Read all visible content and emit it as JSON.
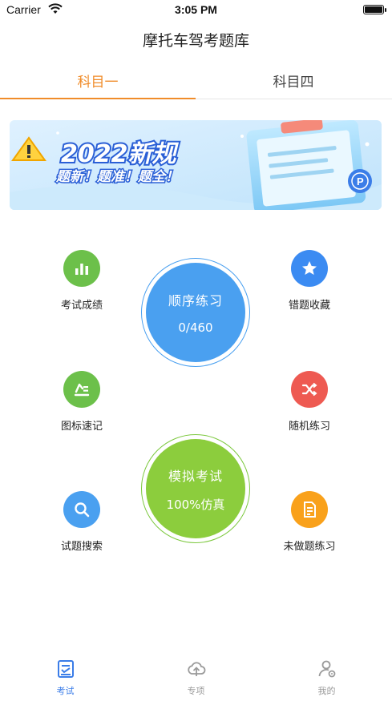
{
  "status_bar": {
    "carrier": "Carrier",
    "time": "3:05 PM"
  },
  "nav": {
    "title": "摩托车驾考题库"
  },
  "tabs": [
    {
      "label": "科目一",
      "active": true
    },
    {
      "label": "科目四",
      "active": false
    }
  ],
  "banner": {
    "headline": "2022新规",
    "subline": "题新！题准！题全！"
  },
  "left_menu": [
    {
      "label": "考试成绩",
      "icon": "bar-chart-icon",
      "color": "#6cc04a"
    },
    {
      "label": "图标速记",
      "icon": "sign-memo-icon",
      "color": "#6cc04a"
    },
    {
      "label": "试题搜索",
      "icon": "search-icon",
      "color": "#4aa0f0"
    }
  ],
  "right_menu": [
    {
      "label": "错题收藏",
      "icon": "star-icon",
      "color": "#3b8bf2"
    },
    {
      "label": "随机练习",
      "icon": "shuffle-icon",
      "color": "#ee5a52"
    },
    {
      "label": "未做题练习",
      "icon": "document-icon",
      "color": "#f9a11b"
    }
  ],
  "sequential": {
    "title": "顺序练习",
    "progress": "0/460",
    "color": "#4aa0f0"
  },
  "mock": {
    "title": "模拟考试",
    "subtitle": "100%仿真",
    "color": "#8ccd3d"
  },
  "tabbar": [
    {
      "label": "考试",
      "icon": "exam-icon",
      "active": true
    },
    {
      "label": "专项",
      "icon": "cloud-upload-icon",
      "active": false
    },
    {
      "label": "我的",
      "icon": "user-settings-icon",
      "active": false
    }
  ],
  "colors": {
    "accent": "#f08c2a",
    "tab_active": "#3b7de8"
  }
}
